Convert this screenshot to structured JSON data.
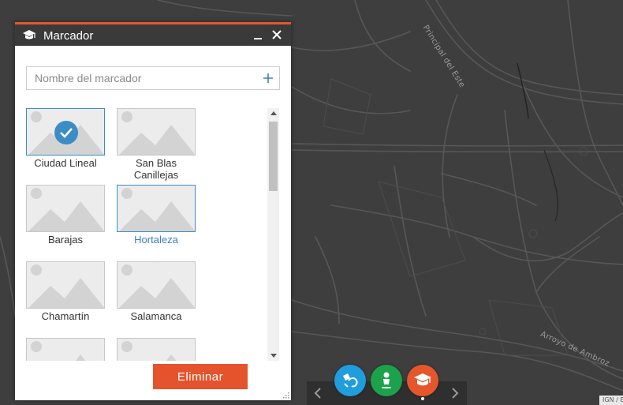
{
  "map": {
    "street_label_1": "Principal del Este",
    "street_label_2": "Arroyo de Ambroz",
    "attribution": "IGN / Esri"
  },
  "panel": {
    "title": "Marcador",
    "header_icon": "graduation-cap-icon",
    "name_placeholder": "Nombre del marcador",
    "name_value": "",
    "delete_label": "Eliminar"
  },
  "bookmarks": [
    {
      "label": "Ciudad Lineal",
      "selected": true
    },
    {
      "label": "San Blas Canillejas",
      "selected": false
    },
    {
      "label": "Barajas",
      "selected": false
    },
    {
      "label": "Hortaleza",
      "selected": false,
      "highlighted": true
    },
    {
      "label": "Chamartín",
      "selected": false
    },
    {
      "label": "Salamanca",
      "selected": false
    }
  ],
  "toolbar": {
    "tools": [
      "measure-icon",
      "person-icon",
      "graduation-cap-icon"
    ],
    "active_index": 2
  },
  "colors": {
    "accent": "#e6562d",
    "selection": "#3c8dc6",
    "tool_blue": "#1f9ddc",
    "tool_green": "#1ca24a",
    "tool_orange": "#e6562d"
  }
}
